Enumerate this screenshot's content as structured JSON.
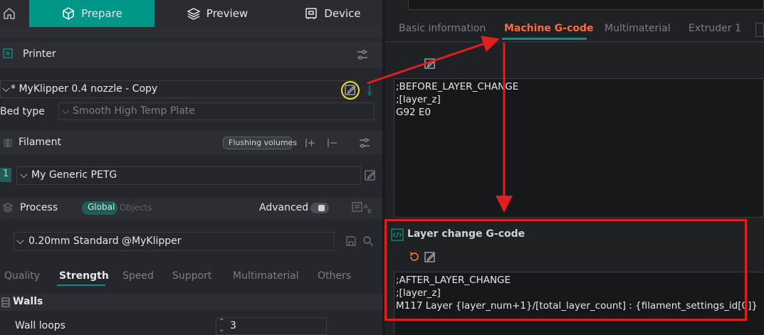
{
  "nav": {
    "prepare": "Prepare",
    "preview": "Preview",
    "device": "Device",
    "accent": "#009688"
  },
  "printer": {
    "section_title": "Printer",
    "preset": "* MyKlipper 0.4 nozzle - Copy",
    "bed_type_label": "Bed type",
    "bed_type_value": "Smooth High Temp Plate"
  },
  "filament": {
    "section_title": "Filament",
    "flushing_button": "Flushing volumes",
    "slot_number": "1",
    "preset": "My Generic PETG"
  },
  "process": {
    "section_title": "Process",
    "scope_global": "Global",
    "scope_objects": "Objects",
    "advanced_label": "Advanced",
    "preset": "0.20mm Standard @MyKlipper",
    "tabs": [
      "Quality",
      "Strength",
      "Speed",
      "Support",
      "Multimaterial",
      "Others"
    ],
    "active_tab": "Strength",
    "walls_title": "Walls",
    "wall_loops_label": "Wall loops",
    "wall_loops_value": "3"
  },
  "editor": {
    "tabs": [
      "Basic information",
      "Machine G-code",
      "Multimaterial",
      "Extruder 1"
    ],
    "active_tab": "Machine G-code",
    "before_layer_code": [
      ";BEFORE_LAYER_CHANGE",
      ";[layer_z]",
      "G92 E0"
    ],
    "layer_change_title": "Layer change G-code",
    "layer_change_code": [
      ";AFTER_LAYER_CHANGE",
      ";[layer_z]",
      "M117 Layer {layer_num+1}/[total_layer_count] : {filament_settings_id[0]}"
    ]
  },
  "colors": {
    "annotation_red": "#e02020",
    "highlight_yellow": "#f0e020",
    "active_tab_orange": "#ff6a3d",
    "teal": "#009688"
  }
}
